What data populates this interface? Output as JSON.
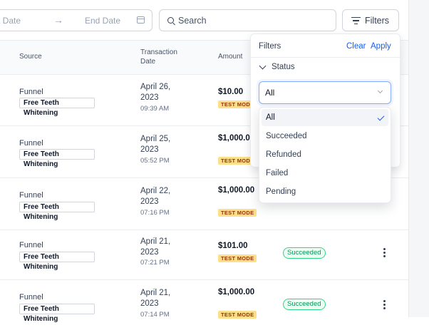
{
  "toolbar": {
    "start_date_placeholder": "rt Date",
    "arrow": "→",
    "end_date_placeholder": "End Date",
    "search_placeholder": "Search",
    "filters_label": "Filters"
  },
  "table": {
    "columns": {
      "source": "Source",
      "transaction_date_1": "Transaction",
      "transaction_date_2": "Date",
      "amount": "Amount"
    },
    "rows": [
      {
        "source": "Funnel",
        "tag": "Free Teeth Whitening",
        "date": "April 26, 2023",
        "time": "09:39 AM",
        "amount": "$10.00",
        "mode": "TEST MODE",
        "status": ""
      },
      {
        "source": "Funnel",
        "tag": "Free Teeth Whitening",
        "date": "April 25, 2023",
        "time": "05:52 PM",
        "amount": "$1,000.00",
        "mode": "TEST MODE",
        "status": ""
      },
      {
        "source": "Funnel",
        "tag": "Free Teeth Whitening",
        "date": "April 22, 2023",
        "time": "07:16 PM",
        "amount": "$1,000.00",
        "mode": "TEST MODE",
        "status": ""
      },
      {
        "source": "Funnel",
        "tag": "Free Teeth Whitening",
        "date": "April 21, 2023",
        "time": "07:21 PM",
        "amount": "$101.00",
        "mode": "TEST MODE",
        "status": "Succeeded"
      },
      {
        "source": "Funnel",
        "tag": "Free Teeth Whitening",
        "date": "April 21, 2023",
        "time": "07:14 PM",
        "amount": "$1,000.00",
        "mode": "TEST MODE",
        "status": "Succeeded"
      }
    ]
  },
  "filter_panel": {
    "title": "Filters",
    "clear": "Clear",
    "apply": "Apply",
    "section": "Status",
    "selected": "All",
    "options": [
      "All",
      "Succeeded",
      "Refunded",
      "Failed",
      "Pending"
    ]
  },
  "colors": {
    "accent": "#155eef",
    "success": "#039855",
    "test_mode_bg": "#fedf89"
  }
}
